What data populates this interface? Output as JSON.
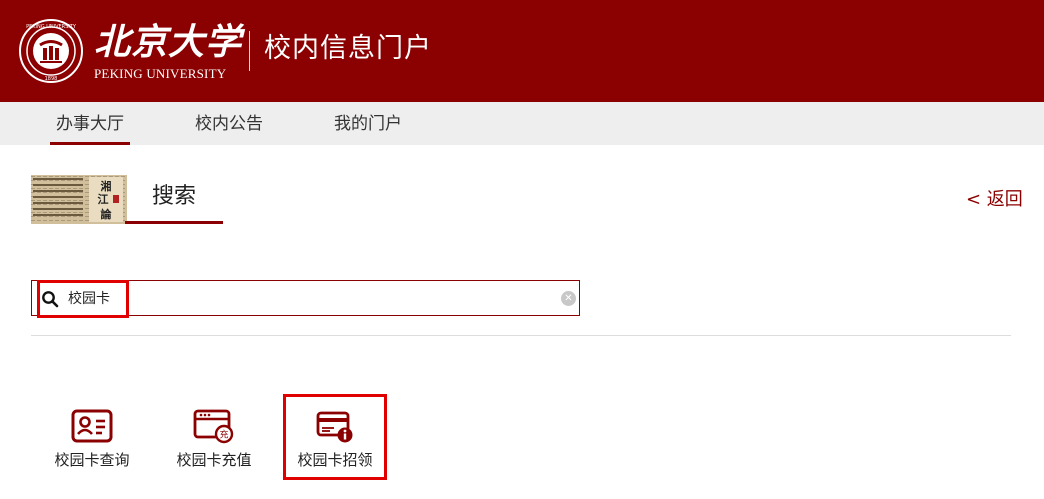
{
  "header": {
    "logo_cn": "北京大学",
    "logo_en": "PEKING UNIVERSITY",
    "portal_title": "校内信息门户",
    "emblem_text": "PEKING UNIVERSITY",
    "emblem_year": "1898",
    "brand_color": "#8b0000"
  },
  "nav": {
    "tabs": [
      {
        "label": "办事大厅",
        "active": true
      },
      {
        "label": "校内公告",
        "active": false
      },
      {
        "label": "我的门户",
        "active": false
      }
    ]
  },
  "section": {
    "title": "搜索",
    "back_label": "< 返回",
    "thumb_text": "湘江評論"
  },
  "search": {
    "value": "校园卡",
    "icon": "search-icon",
    "clear_icon": "clear-icon"
  },
  "apps": [
    {
      "label": "校园卡查询",
      "icon": "id-card-icon"
    },
    {
      "label": "校园卡充值",
      "icon": "card-recharge-icon"
    },
    {
      "label": "校园卡招领",
      "icon": "card-lost-found-icon"
    }
  ]
}
